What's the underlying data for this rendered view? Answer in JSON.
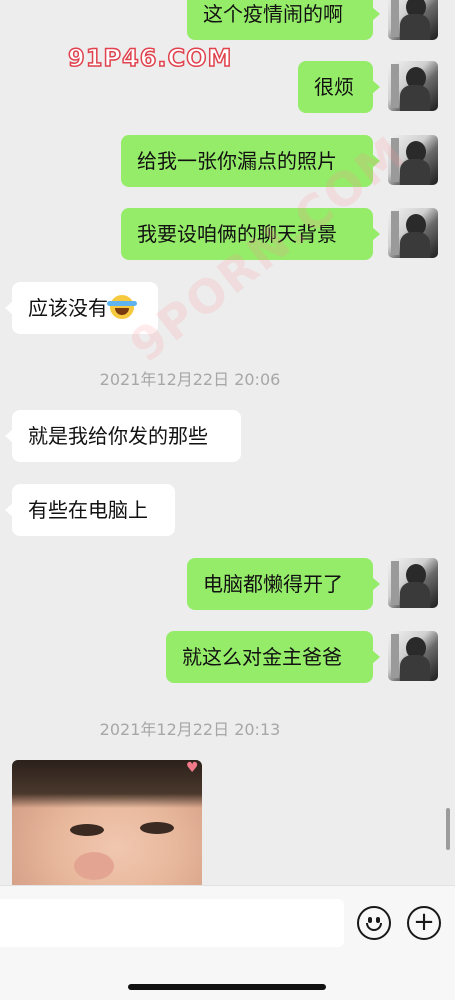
{
  "watermarks": {
    "top": "91P46.COM",
    "diagonal": "9PORN.COM"
  },
  "messages": [
    {
      "side": "out",
      "text": "这个疫情闹的啊"
    },
    {
      "side": "out",
      "text": "很烦"
    },
    {
      "side": "out",
      "text": "给我一张你漏点的照片"
    },
    {
      "side": "out",
      "text": "我要设咱俩的聊天背景"
    },
    {
      "side": "in",
      "text": "应该没有",
      "emoji": "laughing-tears-emoji"
    },
    {
      "side": "in",
      "text": "就是我给你发的那些"
    },
    {
      "side": "in",
      "text": "有些在电脑上"
    },
    {
      "side": "out",
      "text": "电脑都懒得开了"
    },
    {
      "side": "out",
      "text": "就这么对金主爸爸"
    }
  ],
  "timestamps": [
    "2021年12月22日 20:06",
    "2021年12月22日 20:13"
  ],
  "photo": {
    "type": "image",
    "subject": "sticker-photo"
  },
  "input": {
    "placeholder": "",
    "emoji_button": "emoji-icon",
    "plus_button": "+"
  },
  "colors": {
    "outgoing": "#95ec69",
    "incoming": "#ffffff",
    "background": "#ededed"
  }
}
